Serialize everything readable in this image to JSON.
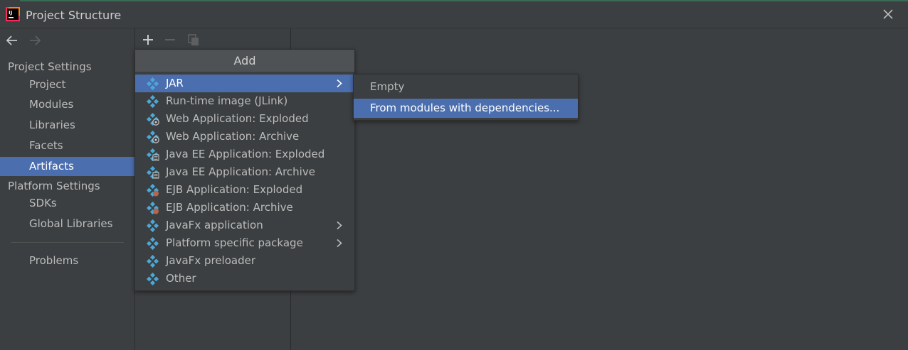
{
  "window": {
    "title": "Project Structure",
    "logo_icon": "intellij-idea-logo",
    "close_icon": "close-icon"
  },
  "colors": {
    "background": "#3c3f41",
    "selection": "#4b6eaf",
    "popup_header": "#4f5254",
    "artifact_icon": "#4aa8d8"
  },
  "nav": {
    "back_icon": "arrow-left-icon",
    "forward_icon": "arrow-right-icon",
    "project_settings": "Project Settings",
    "project_items": [
      "Project",
      "Modules",
      "Libraries",
      "Facets",
      "Artifacts"
    ],
    "selected_item": "Artifacts",
    "platform_settings": "Platform Settings",
    "platform_items": [
      "SDKs",
      "Global Libraries"
    ],
    "problems": "Problems"
  },
  "toolbar": {
    "add_icon": "plus-icon",
    "remove_icon": "minus-icon",
    "copy_icon": "copy-icon"
  },
  "add_popup": {
    "title": "Add",
    "items": [
      {
        "label": "JAR",
        "icon": "artifact-icon",
        "submenu": true,
        "selected": true
      },
      {
        "label": "Run-time image (JLink)",
        "icon": "artifact-icon"
      },
      {
        "label": "Web Application: Exploded",
        "icon": "web-artifact-icon"
      },
      {
        "label": "Web Application: Archive",
        "icon": "web-artifact-icon"
      },
      {
        "label": "Java EE Application: Exploded",
        "icon": "javaee-artifact-icon"
      },
      {
        "label": "Java EE Application: Archive",
        "icon": "javaee-artifact-icon"
      },
      {
        "label": "EJB Application: Exploded",
        "icon": "ejb-artifact-icon"
      },
      {
        "label": "EJB Application: Archive",
        "icon": "ejb-artifact-icon"
      },
      {
        "label": "JavaFx application",
        "icon": "artifact-icon",
        "submenu": true
      },
      {
        "label": "Platform specific package",
        "icon": "artifact-icon",
        "submenu": true
      },
      {
        "label": "JavaFx preloader",
        "icon": "artifact-icon"
      },
      {
        "label": "Other",
        "icon": "artifact-icon"
      }
    ]
  },
  "jar_submenu": {
    "items": [
      {
        "label": "Empty"
      },
      {
        "label": "From modules with dependencies...",
        "selected": true
      }
    ]
  }
}
